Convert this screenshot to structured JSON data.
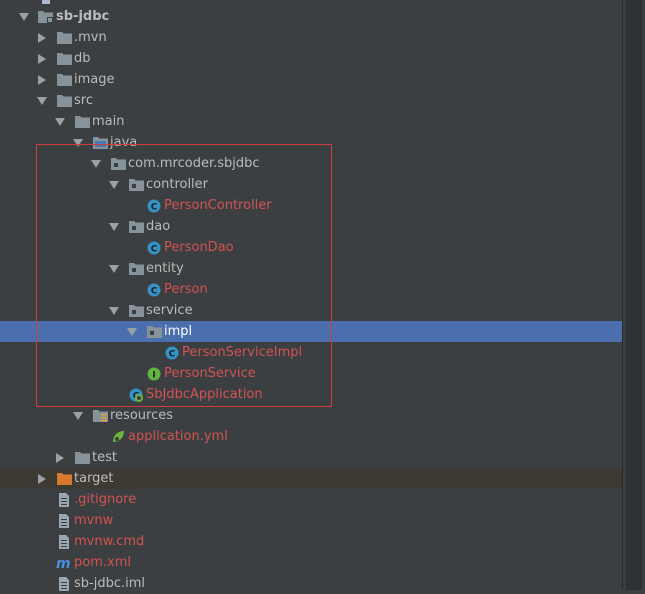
{
  "tree": [
    {
      "label": "sb-jdbc",
      "depth": 0,
      "arrow": "down",
      "icon": "module-folder-icon",
      "color": "normal",
      "bold": true
    },
    {
      "label": ".mvn",
      "depth": 1,
      "arrow": "right",
      "icon": "folder-icon",
      "color": "normal"
    },
    {
      "label": "db",
      "depth": 1,
      "arrow": "right",
      "icon": "folder-icon",
      "color": "normal"
    },
    {
      "label": "image",
      "depth": 1,
      "arrow": "right",
      "icon": "folder-icon",
      "color": "normal"
    },
    {
      "label": "src",
      "depth": 1,
      "arrow": "down",
      "icon": "folder-icon",
      "color": "normal"
    },
    {
      "label": "main",
      "depth": 2,
      "arrow": "down",
      "icon": "folder-icon",
      "color": "normal"
    },
    {
      "label": "java",
      "depth": 3,
      "arrow": "down",
      "icon": "source-folder-icon",
      "color": "normal"
    },
    {
      "label": "com.mrcoder.sbjdbc",
      "depth": 4,
      "arrow": "down",
      "icon": "package-icon",
      "color": "normal"
    },
    {
      "label": "controller",
      "depth": 5,
      "arrow": "down",
      "icon": "package-icon",
      "color": "normal"
    },
    {
      "label": "PersonController",
      "depth": 6,
      "arrow": "none",
      "icon": "class-icon",
      "color": "red"
    },
    {
      "label": "dao",
      "depth": 5,
      "arrow": "down",
      "icon": "package-icon",
      "color": "normal"
    },
    {
      "label": "PersonDao",
      "depth": 6,
      "arrow": "none",
      "icon": "class-icon",
      "color": "red"
    },
    {
      "label": "entity",
      "depth": 5,
      "arrow": "down",
      "icon": "package-icon",
      "color": "normal"
    },
    {
      "label": "Person",
      "depth": 6,
      "arrow": "none",
      "icon": "class-icon",
      "color": "red"
    },
    {
      "label": "service",
      "depth": 5,
      "arrow": "down",
      "icon": "package-icon",
      "color": "normal"
    },
    {
      "label": "impl",
      "depth": 6,
      "arrow": "down",
      "icon": "package-icon",
      "color": "normal",
      "selected": true
    },
    {
      "label": "PersonServiceImpl",
      "depth": 7,
      "arrow": "none",
      "icon": "class-icon",
      "color": "red"
    },
    {
      "label": "PersonService",
      "depth": 6,
      "arrow": "none",
      "icon": "interface-icon",
      "color": "red"
    },
    {
      "label": "SbJdbcApplication",
      "depth": 5,
      "arrow": "none",
      "icon": "spring-boot-class-icon",
      "color": "red"
    },
    {
      "label": "resources",
      "depth": 3,
      "arrow": "down",
      "icon": "resources-folder-icon",
      "color": "normal"
    },
    {
      "label": "application.yml",
      "depth": 4,
      "arrow": "none",
      "icon": "spring-yml-icon",
      "color": "red"
    },
    {
      "label": "test",
      "depth": 2,
      "arrow": "right",
      "icon": "folder-icon",
      "color": "normal"
    },
    {
      "label": "target",
      "depth": 1,
      "arrow": "right",
      "icon": "excluded-folder-icon",
      "color": "normal",
      "excluded": true
    },
    {
      "label": ".gitignore",
      "depth": 1,
      "arrow": "none",
      "icon": "file-icon",
      "color": "red"
    },
    {
      "label": "mvnw",
      "depth": 1,
      "arrow": "none",
      "icon": "file-icon",
      "color": "red"
    },
    {
      "label": "mvnw.cmd",
      "depth": 1,
      "arrow": "none",
      "icon": "file-icon",
      "color": "red"
    },
    {
      "label": "pom.xml",
      "depth": 1,
      "arrow": "none",
      "icon": "maven-icon",
      "color": "red"
    },
    {
      "label": "sb-jdbc.iml",
      "depth": 1,
      "arrow": "none",
      "icon": "file-icon",
      "color": "normal"
    }
  ],
  "colors": {
    "background": "#3c3f41",
    "text": "#bbbbbb",
    "untracked": "#d25252",
    "selection": "#4b6eaf",
    "highlight_box": "#d23c3c",
    "folder": "#87939a",
    "class_icon": "#3592c4",
    "interface_icon": "#62b543",
    "excluded_folder": "#d9782f"
  }
}
